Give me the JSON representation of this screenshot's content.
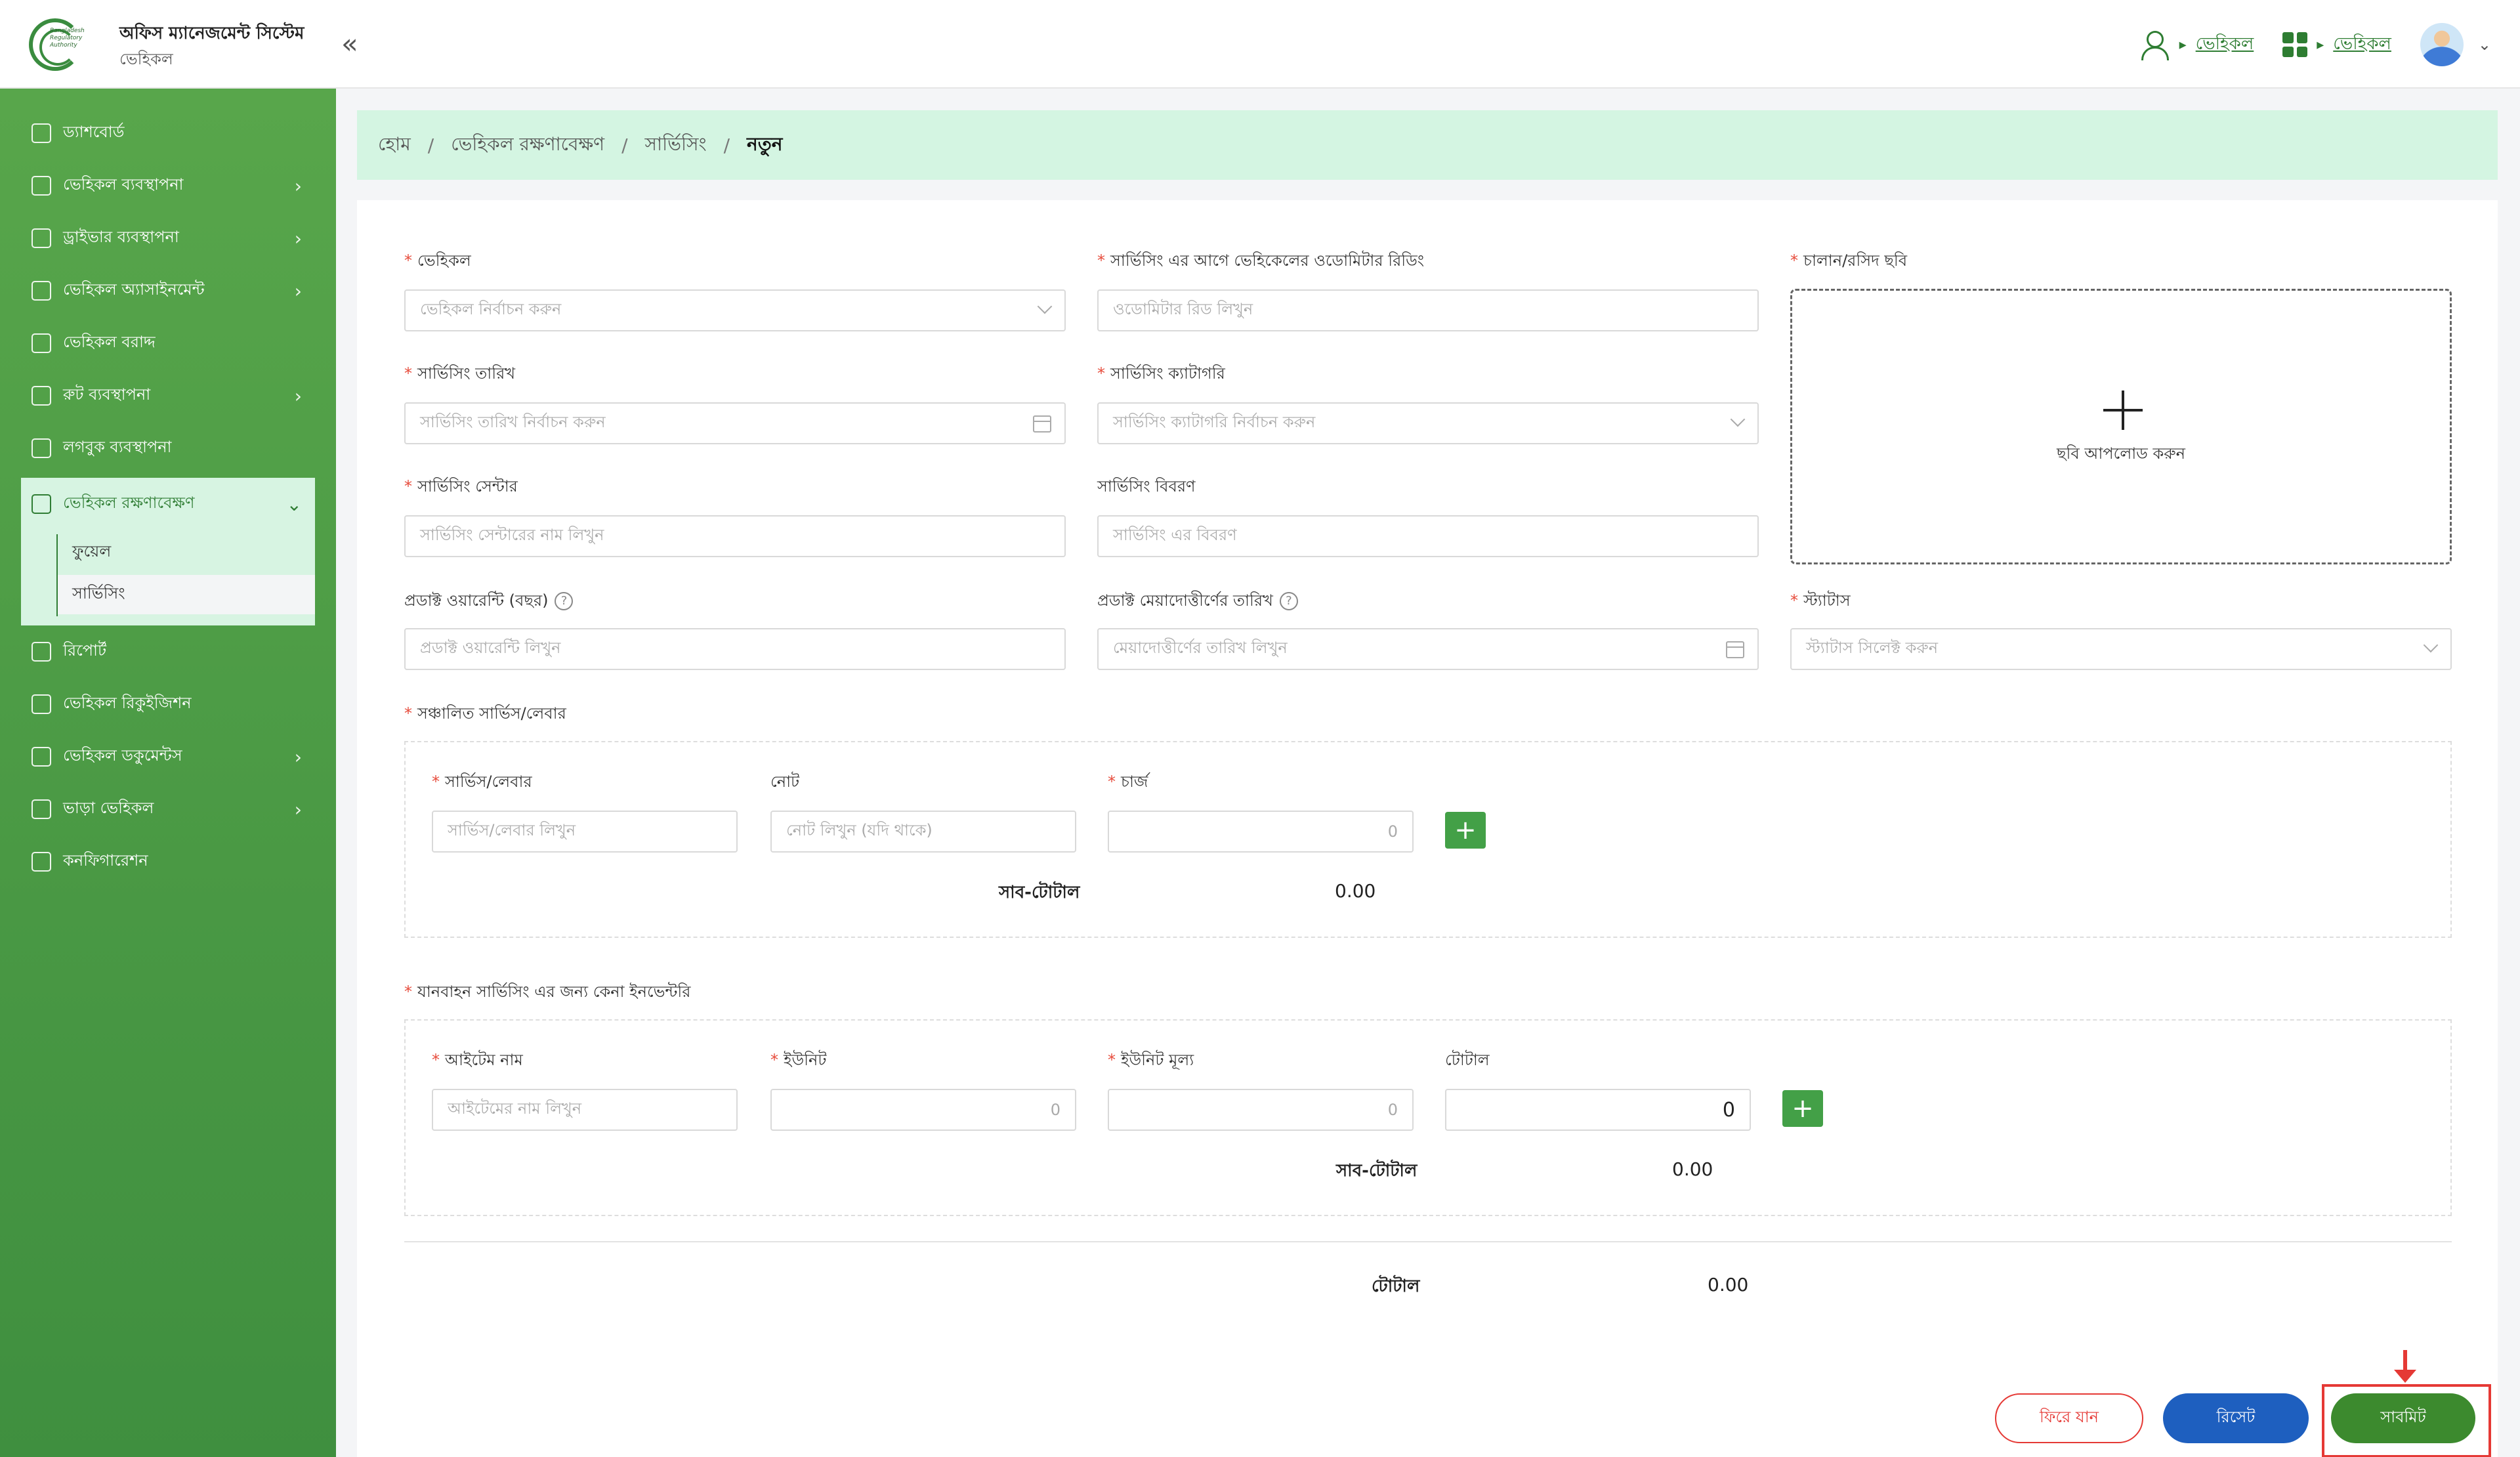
{
  "header": {
    "logo_text": "Bangladesh\nRegulatory\nAuthority",
    "app_title": "অফিস ম্যানেজমেন্ট সিস্টেম",
    "app_subtitle": "ভেহিকল",
    "crumb_left": "ভেহিকল",
    "crumb_right": "ভেহিকল",
    "collapse_icon": "«",
    "arrow": "▸",
    "caret": "⌄"
  },
  "sidebar": {
    "items": [
      {
        "label": "ড্যাশবোর্ড",
        "icon": "dashboard-icon",
        "chevron": false
      },
      {
        "label": "ভেহিকল ব্যবস্থাপনা",
        "icon": "car-icon",
        "chevron": true
      },
      {
        "label": "ড্রাইভার ব্যবস্থাপনা",
        "icon": "users-icon",
        "chevron": true
      },
      {
        "label": "ভেহিকল অ্যাসাইনমেন্ট",
        "icon": "clipboard-icon",
        "chevron": true
      },
      {
        "label": "ভেহিকল বরাদ্দ",
        "icon": "allocation-icon",
        "chevron": false
      },
      {
        "label": "রুট ব্যবস্থাপনা",
        "icon": "route-icon",
        "chevron": true
      },
      {
        "label": "লগবুক ব্যবস্থাপনা",
        "icon": "logbook-icon",
        "chevron": false
      }
    ],
    "open_group": {
      "label": "ভেহিকল রক্ষণাবেক্ষণ",
      "icon": "wrench-icon",
      "subs": [
        "ফুয়েল",
        "সার্ভিসিং"
      ]
    },
    "items_after": [
      {
        "label": "রিপোর্ট",
        "icon": "report-icon",
        "chevron": false
      },
      {
        "label": "ভেহিকল রিকুইজিশন",
        "icon": "requisition-icon",
        "chevron": false
      },
      {
        "label": "ভেহিকল ডকুমেন্টস",
        "icon": "documents-icon",
        "chevron": true
      },
      {
        "label": "ভাড়া ভেহিকল",
        "icon": "rent-icon",
        "chevron": true
      },
      {
        "label": "কনফিগারেশন",
        "icon": "sliders-icon",
        "chevron": false
      }
    ],
    "chevron_right": "›",
    "chevron_down": "⌄"
  },
  "breadcrumb": {
    "items": [
      "হোম",
      "ভেহিকল রক্ষণাবেক্ষণ",
      "সার্ভিসিং"
    ],
    "current": "নতুন",
    "sep": "/"
  },
  "form": {
    "vehicle": {
      "label": "ভেহিকল",
      "placeholder": "ভেহিকল নির্বাচন করুন"
    },
    "odometer": {
      "label": "সার্ভিসিং এর আগে ভেহিকেলের ওডোমিটার রিডিং",
      "placeholder": "ওডোমিটার রিড লিখুন"
    },
    "invoice_image": {
      "label": "চালান/রসিদ ছবি",
      "upload_text": "ছবি আপলোড করুন"
    },
    "service_date": {
      "label": "সার্ভিসিং তারিখ",
      "placeholder": "সার্ভিসিং তারিখ নির্বাচন করুন"
    },
    "service_category": {
      "label": "সার্ভিসিং ক্যাটাগরি",
      "placeholder": "সার্ভিসিং ক্যাটাগরি নির্বাচন করুন"
    },
    "service_center": {
      "label": "সার্ভিসিং সেন্টার",
      "placeholder": "সার্ভিসিং সেন্টারের নাম লিখুন"
    },
    "service_desc": {
      "label": "সার্ভিসিং বিবরণ",
      "placeholder": "সার্ভিসিং এর বিবরণ"
    },
    "warranty": {
      "label": "প্রডাক্ট ওয়ারেন্টি (বছর)",
      "placeholder": "প্রডাক্ট ওয়ারেন্টি লিখুন",
      "help": "?"
    },
    "expiry": {
      "label": "প্রডাক্ট মেয়াদোত্তীর্ণের তারিখ",
      "placeholder": "মেয়াদোত্তীর্ণের তারিখ লিখুন",
      "help": "?"
    },
    "status": {
      "label": "স্ট্যাটাস",
      "placeholder": "স্ট্যাটাস সিলেক্ট করুন"
    },
    "labor_section": {
      "title": "সঞ্চালিত সার্ভিস/লেবার",
      "service_label": "সার্ভিস/লেবার",
      "service_placeholder": "সার্ভিস/লেবার লিখুন",
      "note_label": "নোট",
      "note_placeholder": "নোট লিখুন (যদি থাকে)",
      "charge_label": "চার্জ",
      "charge_value": "0",
      "add": "+",
      "subtotal_label": "সাব-টোটাল",
      "subtotal_value": "0.00"
    },
    "inventory_section": {
      "title": "যানবাহন সার্ভিসিং এর জন্য কেনা ইনভেন্টরি",
      "item_label": "আইটেম নাম",
      "item_placeholder": "আইটেমের নাম লিখুন",
      "unit_label": "ইউনিট",
      "unit_value": "0",
      "price_label": "ইউনিট মূল্য",
      "price_value": "0",
      "total_label": "টোটাল",
      "total_value": "0",
      "add": "+",
      "subtotal_label": "সাব-টোটাল",
      "subtotal_value": "0.00"
    },
    "grand_total_label": "টোটাল",
    "grand_total_value": "0.00",
    "required_mark": "*"
  },
  "buttons": {
    "back": "ফিরে যান",
    "reset": "রিসেট",
    "submit": "সাবমিট"
  },
  "colors": {
    "primary_green": "#43a047",
    "breadcrumb_bg": "#d4f5e2",
    "highlight_red": "#e53935",
    "reset_blue": "#1e5fbf"
  }
}
